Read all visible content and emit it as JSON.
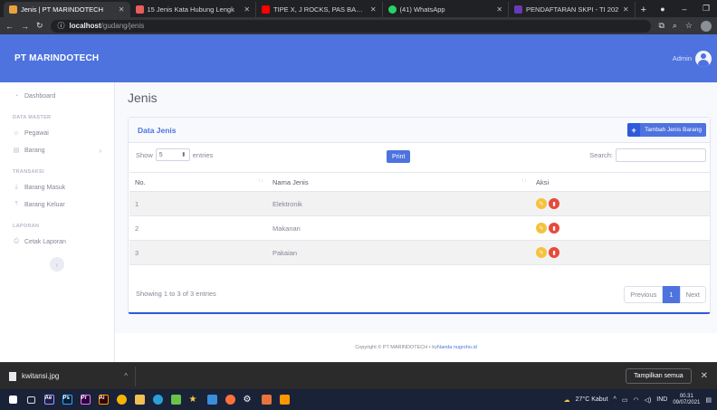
{
  "browser": {
    "tabs": [
      {
        "title": "Jenis | PT MARINDOTECH",
        "icon": "favicon-app",
        "active": true,
        "color": "#e8a33d"
      },
      {
        "title": "15 Jenis Kata Hubung Lengk",
        "icon": "favicon-search",
        "active": false,
        "color": "#e85d5d"
      },
      {
        "title": "TIPE X, J ROCKS, PAS BAND, F",
        "icon": "favicon-youtube",
        "active": false,
        "color": "#ff0000"
      },
      {
        "title": "(41) WhatsApp",
        "icon": "favicon-whatsapp",
        "active": false,
        "color": "#25d366"
      },
      {
        "title": "PENDAFTARAN SKPI - TI 202",
        "icon": "favicon-forms",
        "active": false,
        "color": "#673ab7"
      }
    ],
    "new_tab": "+",
    "url_host": "localhost",
    "url_path": "/gudang/jenis"
  },
  "app": {
    "brand": "PT MARINDOTECH",
    "user_name": "Admin"
  },
  "sidebar": {
    "dashboard": "Dashboard",
    "heading_master": "DATA MASTER",
    "pegawai": "Pegawai",
    "barang": "Barang",
    "heading_transaksi": "TRANSAKSI",
    "barang_masuk": "Barang Masuk",
    "barang_keluar": "Barang Keluar",
    "heading_laporan": "LAPORAN",
    "cetak_laporan": "Cetak Laporan",
    "toggle": "‹"
  },
  "page": {
    "title": "Jenis",
    "card_title": "Data Jenis",
    "add_button": "Tambah Jenis Barang",
    "show_label": "Show",
    "show_value": "5",
    "entries_label": "entries",
    "print_button": "Print",
    "search_label": "Search:",
    "columns": [
      "No.",
      "Nama Jenis",
      "Aksi"
    ],
    "rows": [
      {
        "no": "1",
        "nama": "Elektronik"
      },
      {
        "no": "2",
        "nama": "Makanan"
      },
      {
        "no": "3",
        "nama": "Pakaian"
      }
    ],
    "info": "Showing 1 to 3 of 3 entries",
    "pager": {
      "prev": "Previous",
      "current": "1",
      "next": "Next"
    }
  },
  "footer": {
    "text": "Copyright © PT MARINDOTECH • by ",
    "link": "Nanda nugroho.id"
  },
  "downloads": {
    "file": "kwitansi.jpg",
    "show_all": "Tampilkan semua"
  },
  "taskbar": {
    "weather": "27°C  Kabut",
    "lang": "IND",
    "time": "00.31",
    "date": "09/07/2021"
  },
  "colors": {
    "primary": "#4e73df",
    "warning": "#f6c23e",
    "danger": "#e74a3b"
  }
}
